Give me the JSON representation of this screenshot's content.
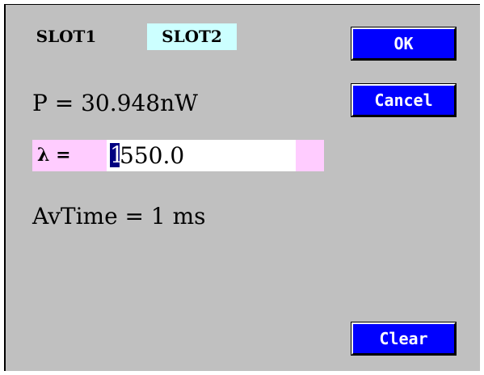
{
  "tabs": [
    {
      "label": "SLOT1",
      "selected": false
    },
    {
      "label": "SLOT2",
      "selected": true
    }
  ],
  "buttons": {
    "ok": "OK",
    "cancel": "Cancel",
    "clear": "Clear"
  },
  "power": {
    "text": "P = 30.948nW"
  },
  "wavelength": {
    "label": "λ =",
    "cursor_digit": "1",
    "value_rest": "550.0"
  },
  "avtime": {
    "text": "AvTime = 1 ms"
  },
  "colors": {
    "panel": "#c0c0c0",
    "button": "#0000ff",
    "button_text": "#ffffff",
    "selected_tab": "#ccffff",
    "edit_row": "#ffccff",
    "cursor": "#000080"
  }
}
